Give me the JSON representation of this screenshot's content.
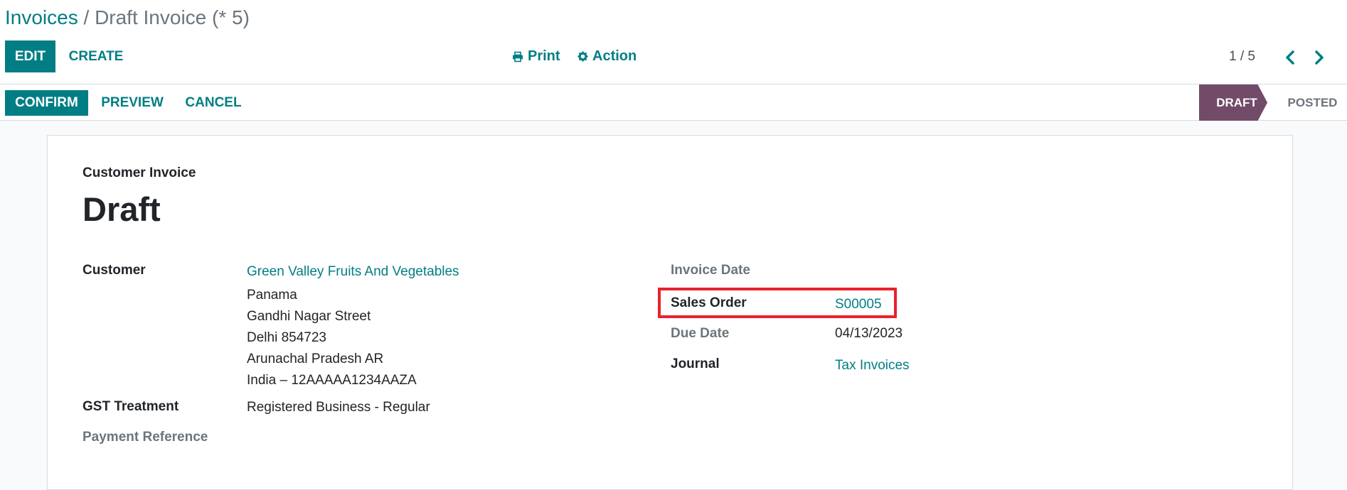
{
  "breadcrumb": {
    "parent": "Invoices",
    "separator": " / ",
    "current": "Draft Invoice (* 5)"
  },
  "toolbar": {
    "edit_label": "EDIT",
    "create_label": "CREATE",
    "print_label": "Print",
    "action_label": "Action",
    "print_icon": "printer-icon",
    "action_icon": "gear-icon"
  },
  "pager": {
    "value": "1 / 5",
    "prev_icon": "chevron-left-icon",
    "next_icon": "chevron-right-icon"
  },
  "statusbar": {
    "confirm_label": "CONFIRM",
    "preview_label": "PREVIEW",
    "cancel_label": "CANCEL",
    "stages": [
      "DRAFT",
      "POSTED"
    ],
    "active_stage": "DRAFT"
  },
  "form": {
    "doc_type": "Customer Invoice",
    "doc_name": "Draft",
    "customer": {
      "label": "Customer",
      "name": "Green Valley Fruits And Vegetables",
      "address_lines": [
        "Panama",
        "Gandhi Nagar Street",
        "Delhi 854723",
        "Arunachal Pradesh AR",
        "India – 12AAAAA1234AAZA"
      ]
    },
    "gst_treatment": {
      "label": "GST Treatment",
      "value": "Registered Business - Regular"
    },
    "payment_reference": {
      "label": "Payment Reference",
      "value": ""
    },
    "invoice_date": {
      "label": "Invoice Date",
      "value": ""
    },
    "sales_order": {
      "label": "Sales Order",
      "value": "S00005"
    },
    "due_date": {
      "label": "Due Date",
      "value": "04/13/2023"
    },
    "journal": {
      "label": "Journal",
      "value": "Tax Invoices"
    }
  },
  "colors": {
    "primary": "#017e84",
    "draft_stage": "#714b67",
    "highlight": "#e8222d"
  }
}
